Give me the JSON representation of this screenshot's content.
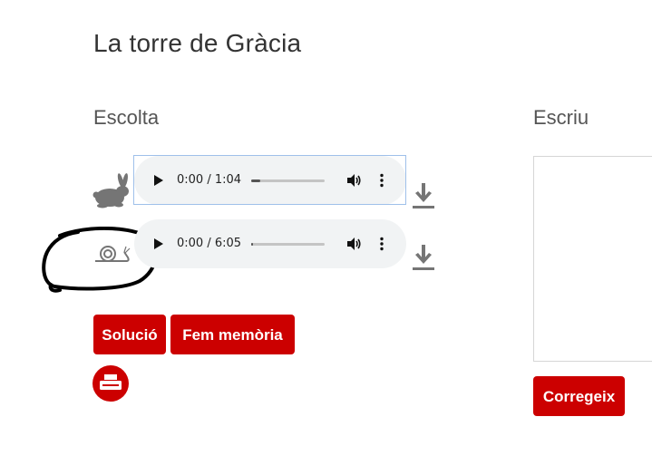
{
  "page": {
    "title": "La torre de Gràcia"
  },
  "listen": {
    "heading": "Escolta",
    "players": [
      {
        "time": "0:00 / 1:04",
        "progress": 0.12,
        "speed_icon": "rabbit-icon"
      },
      {
        "time": "0:00 / 6:05",
        "progress": 0.02,
        "speed_icon": "snail-icon"
      }
    ],
    "buttons": {
      "solution": "Solució",
      "memory": "Fem memòria"
    },
    "print_icon": "printer-icon"
  },
  "write": {
    "heading": "Escriu",
    "text_value": "",
    "check_button": "Corregeix"
  },
  "colors": {
    "accent": "#cc0000",
    "player_bg": "#f1f3f4",
    "icon_gray": "#757575",
    "focus": "#9fc0ea"
  }
}
